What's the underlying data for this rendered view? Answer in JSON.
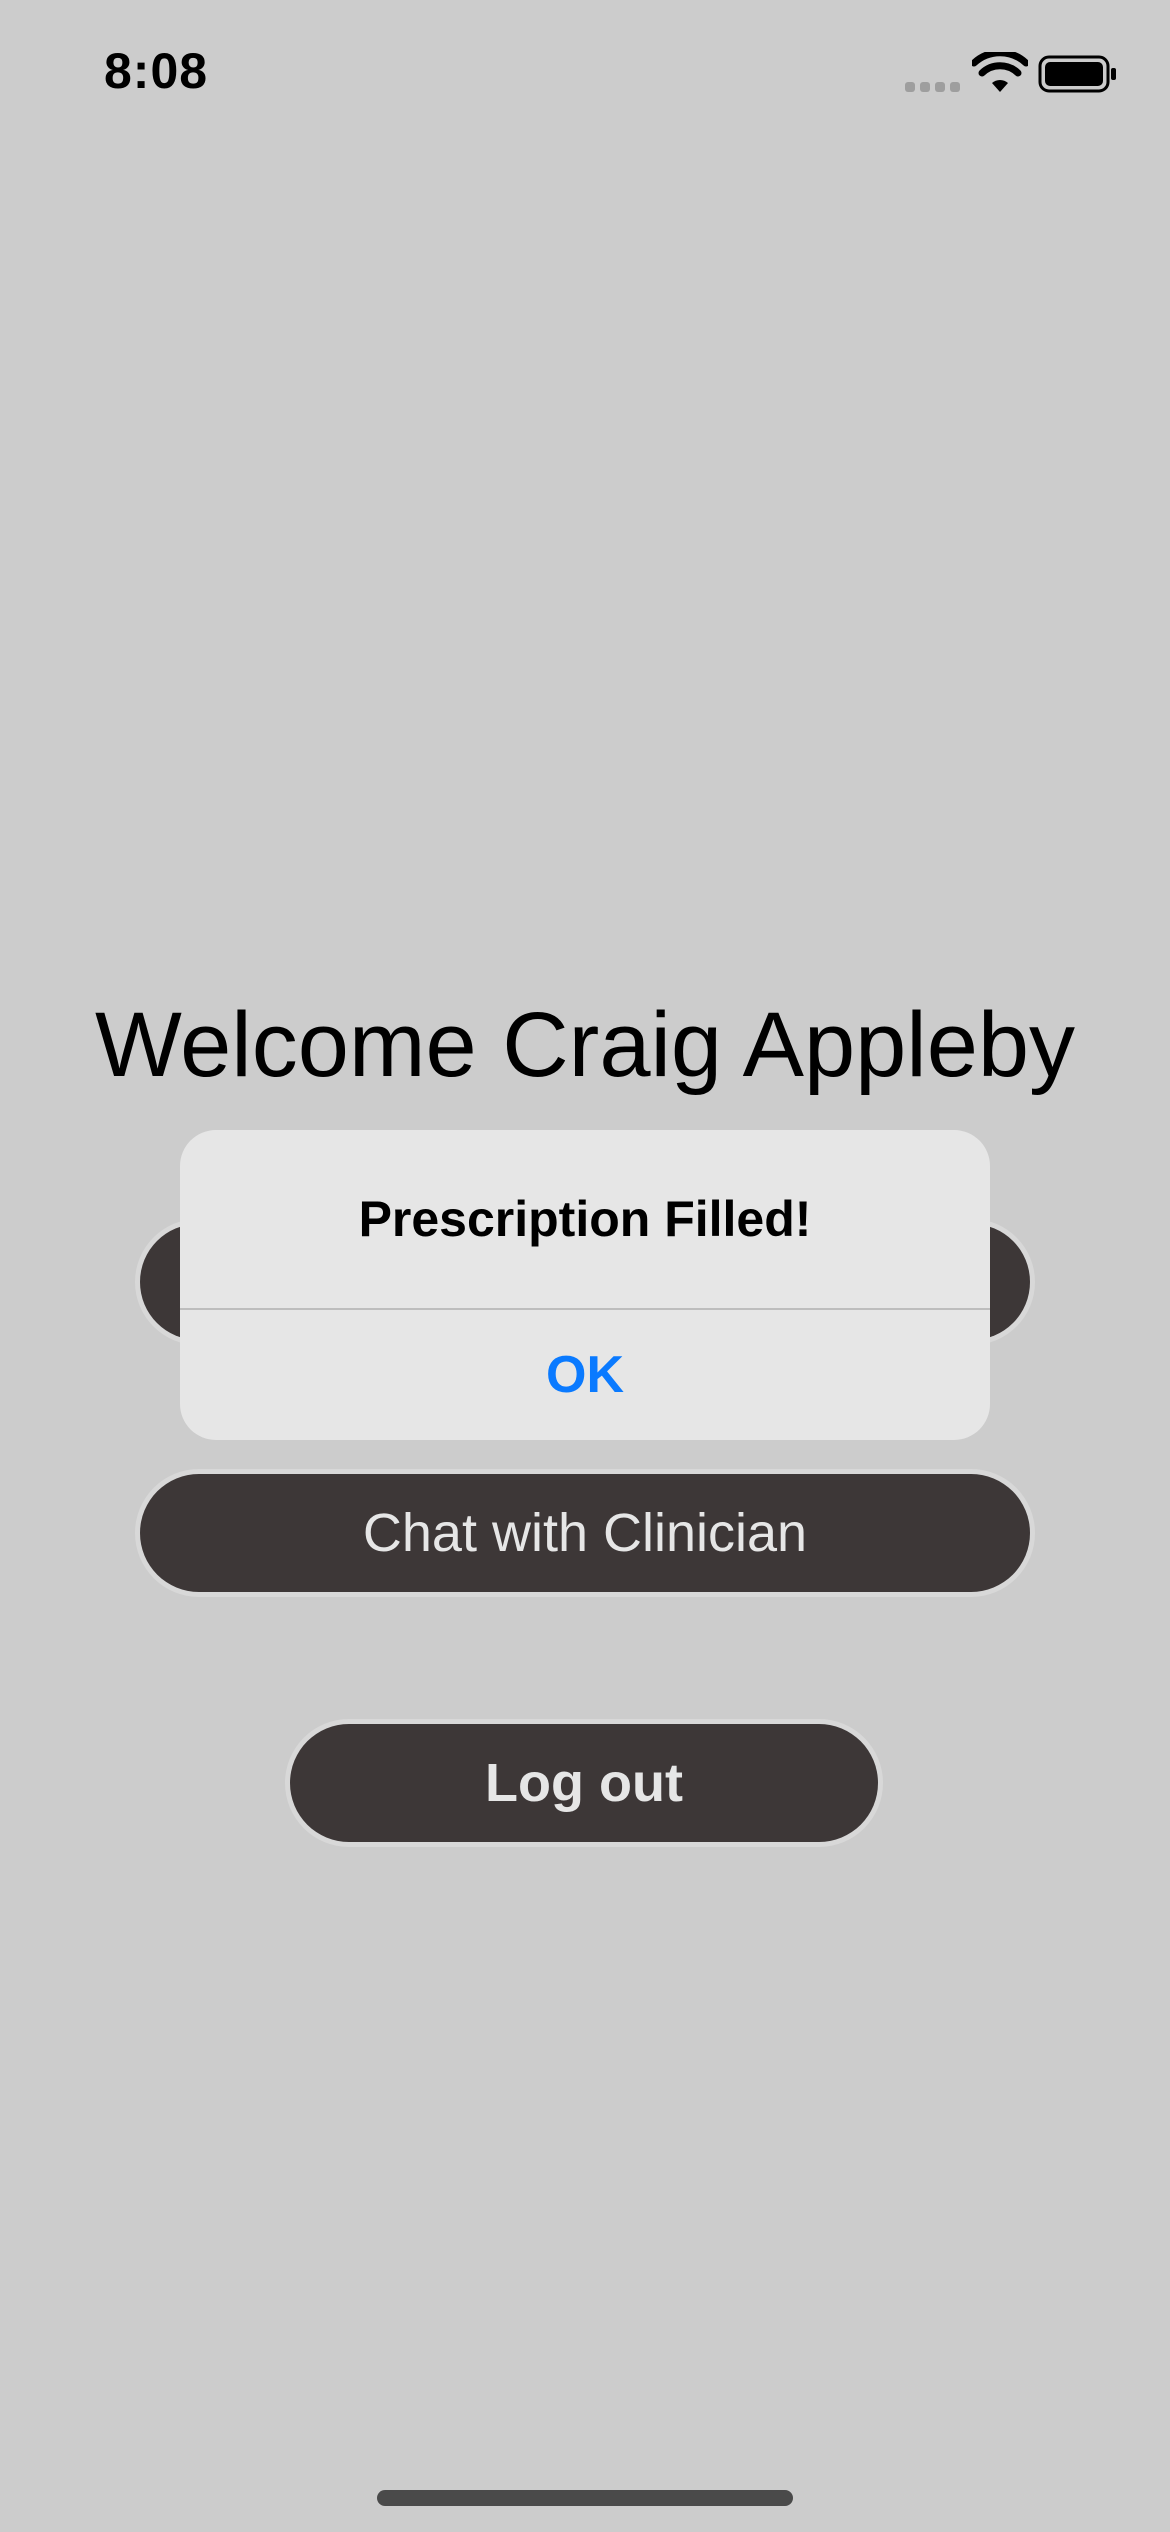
{
  "status_bar": {
    "time": "8:08",
    "icons": [
      "cellular-signal-icon",
      "wifi-icon",
      "battery-icon"
    ]
  },
  "main": {
    "welcome_title": "Welcome Craig Appleby",
    "chat_button_label": "Chat with Clinician",
    "logout_button_label": "Log out"
  },
  "alert": {
    "title": "Prescription Filled!",
    "ok_label": "OK"
  },
  "colors": {
    "background": "#cccccc",
    "button_fill": "#3d3737",
    "button_text": "#e6e6e6",
    "alert_background": "#e6e6e6",
    "alert_action": "#0a7aff"
  }
}
